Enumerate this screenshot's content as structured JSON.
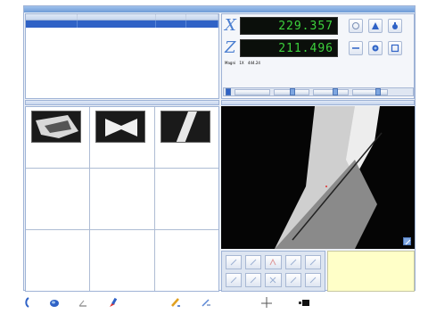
{
  "list": {
    "rows": [
      {
        "cells": [
          "",
          "",
          "",
          ""
        ],
        "selected": true
      }
    ]
  },
  "dro": {
    "x_label": "X",
    "z_label": "Z",
    "x_value": "229.357",
    "z_value": "211.496",
    "status": [
      "Magni",
      "1X",
      "444.24"
    ]
  },
  "colors": {
    "accent": "#2f62c6",
    "dro_digits": "#3cd23c",
    "note_bg": "#ffffc8"
  },
  "icons": [
    "settings-icon",
    "triangle-icon",
    "probe-icon",
    "line-icon",
    "lens-icon",
    "window-icon",
    "zoom-icon",
    "fit-icon",
    "color-picker-icon",
    "pen-icon",
    "crosshair-icon",
    "camera-icon"
  ]
}
